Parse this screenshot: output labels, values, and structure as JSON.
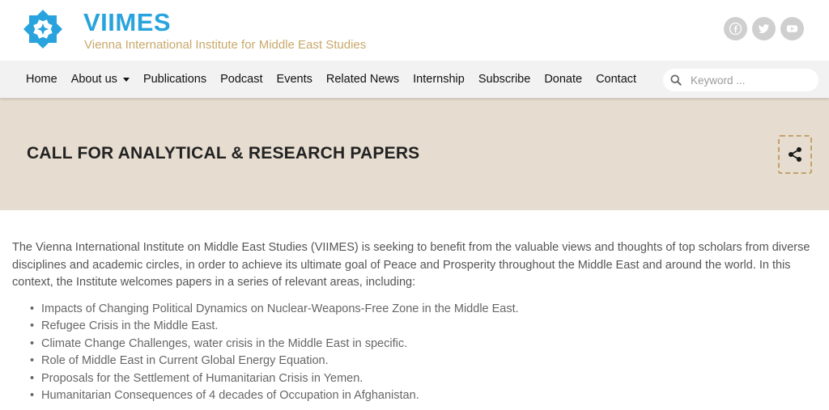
{
  "brand": {
    "name": "VIIMES",
    "subtitle": "Vienna International Institute for Middle East Studies",
    "colors": {
      "primary": "#29a3dd",
      "accent": "#c8a86a"
    }
  },
  "social": [
    {
      "icon": "facebook-icon"
    },
    {
      "icon": "twitter-icon"
    },
    {
      "icon": "youtube-icon"
    }
  ],
  "nav": {
    "items": [
      {
        "label": "Home"
      },
      {
        "label": "About us",
        "dropdown": true
      },
      {
        "label": "Publications"
      },
      {
        "label": "Podcast"
      },
      {
        "label": "Events"
      },
      {
        "label": "Related News"
      },
      {
        "label": "Internship"
      },
      {
        "label": "Subscribe"
      },
      {
        "label": "Donate"
      },
      {
        "label": "Contact"
      }
    ],
    "search_placeholder": "Keyword ..."
  },
  "banner": {
    "title": "CALL FOR ANALYTICAL & RESEARCH PAPERS",
    "background": "#e6ddd0"
  },
  "content": {
    "intro": "The Vienna International Institute on Middle East Studies (VIIMES) is seeking to benefit from the valuable views and thoughts of top scholars from diverse disciplines and academic circles, in order to achieve its ultimate goal of Peace and Prosperity throughout the Middle East and around the world. In this context, the Institute welcomes papers in a series of relevant areas, including:",
    "list": [
      "Impacts of Changing Political Dynamics on Nuclear-Weapons-Free Zone in the Middle East.",
      "Refugee Crisis in the Middle East.",
      "Climate Change Challenges, water crisis in the Middle East in specific.",
      "Role of Middle East in Current Global Energy Equation.",
      "Proposals for the Settlement of Humanitarian Crisis in Yemen.",
      "Humanitarian Consequences of 4 decades of Occupation in Afghanistan."
    ]
  }
}
